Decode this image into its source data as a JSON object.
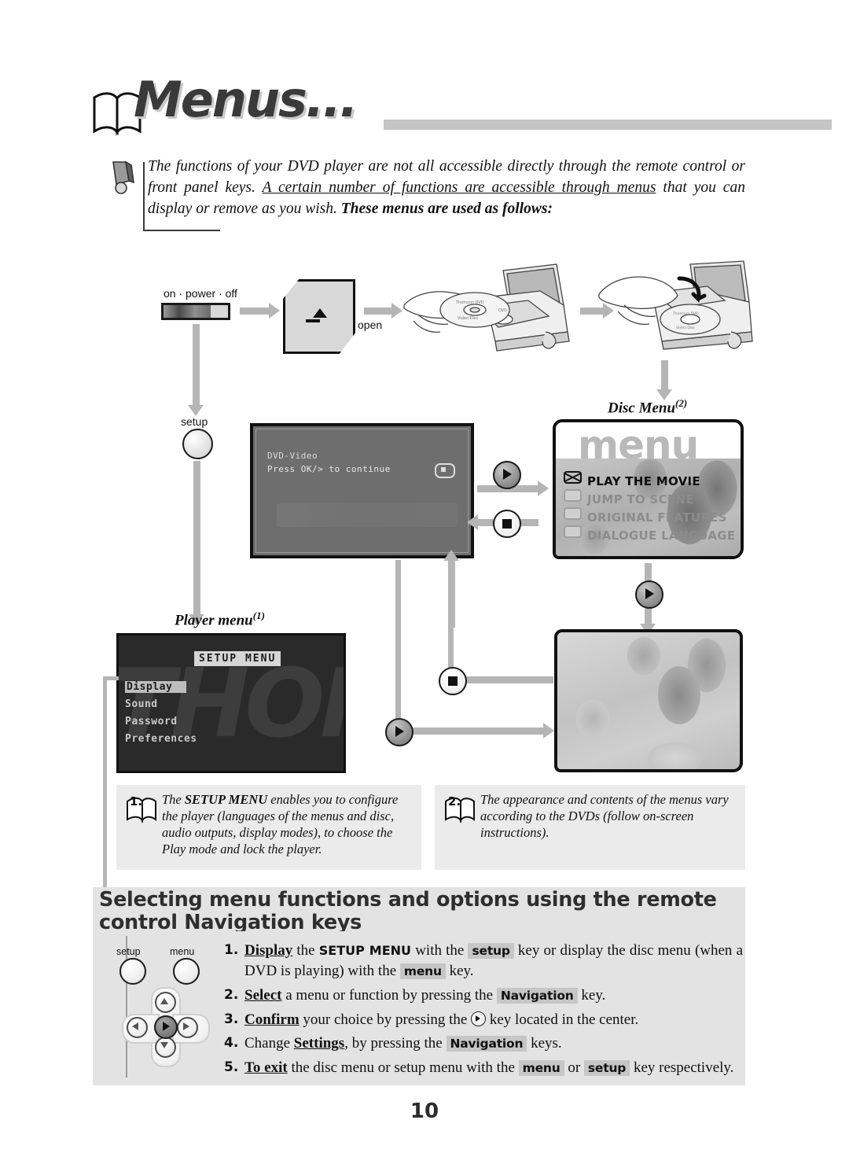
{
  "title": "Menus...",
  "intro": {
    "part1": "The functions of your DVD player are not all accessible directly through the remote control or front panel keys. ",
    "underlined": "A certain number of functions are accessible through menus",
    "part2": " that you can display or remove as you wish. ",
    "bold": "These menus are used as follows:"
  },
  "diagram": {
    "power_label": "on · power · off",
    "open_label": "open",
    "setup_label": "setup",
    "screen1": {
      "line1": "DVD-Video",
      "line2": "Press OK/>  to continue"
    },
    "disc_menu": {
      "caption": "Disc Menu",
      "caption_note": "(2)",
      "watermark": "menu",
      "items": [
        {
          "label": "PLAY THE MOVIE",
          "selected": true
        },
        {
          "label": "JUMP TO SCENE",
          "selected": false
        },
        {
          "label": "ORIGINAL FEATURES",
          "selected": false
        },
        {
          "label": "DIALOGUE LANGUAGE",
          "selected": false
        }
      ]
    },
    "player_menu": {
      "caption": "Player menu",
      "caption_note": "(1)",
      "watermark": "THOMSON",
      "title": "SETUP MENU",
      "items": [
        {
          "label": "Display",
          "highlighted": true
        },
        {
          "label": "Sound",
          "highlighted": false
        },
        {
          "label": "Password",
          "highlighted": false
        },
        {
          "label": "Preferences",
          "highlighted": false
        }
      ]
    }
  },
  "notes": [
    {
      "number": "1.",
      "text_pre": "The ",
      "text_bold": "SETUP MENU",
      "text_post": " enables you to configure the player (languages of the menus and disc, audio outputs, display modes), to choose the Play mode and lock the player."
    },
    {
      "number": "2.",
      "text_pre": "",
      "text_bold": "",
      "text_post": "The appearance and contents of the menus vary according to the DVDs (follow on-screen instructions)."
    }
  ],
  "section": {
    "heading": "Selecting menu functions and options using the remote control Navigation keys"
  },
  "remote": {
    "setup_key": "setup",
    "menu_key": "menu"
  },
  "steps": [
    {
      "num": "1.",
      "action": "Display",
      "seg1": " the ",
      "cap1": "SETUP MENU",
      "seg2": " with the ",
      "cap2": "setup",
      "seg3": " key or display the disc menu (when a DVD is playing) with the ",
      "cap3": "menu",
      "seg4": " key."
    },
    {
      "num": "2.",
      "action": "Select",
      "seg1": " a menu or function by pressing the ",
      "cap1": "Navigation",
      "seg2": " key."
    },
    {
      "num": "3.",
      "action": "Confirm",
      "seg1": " your choice by pressing the ",
      "seg2": " key located in the center."
    },
    {
      "num": "4.",
      "pre": "Change ",
      "action": "Settings",
      "seg1": ", by pressing the ",
      "cap1": "Navigation",
      "seg2": " keys."
    },
    {
      "num": "5.",
      "action": "To exit",
      "seg1": " the disc menu or setup menu with the ",
      "cap1": "menu",
      "seg2": " or ",
      "cap2": "setup",
      "seg3": " key respectively."
    }
  ],
  "page_number": "10"
}
